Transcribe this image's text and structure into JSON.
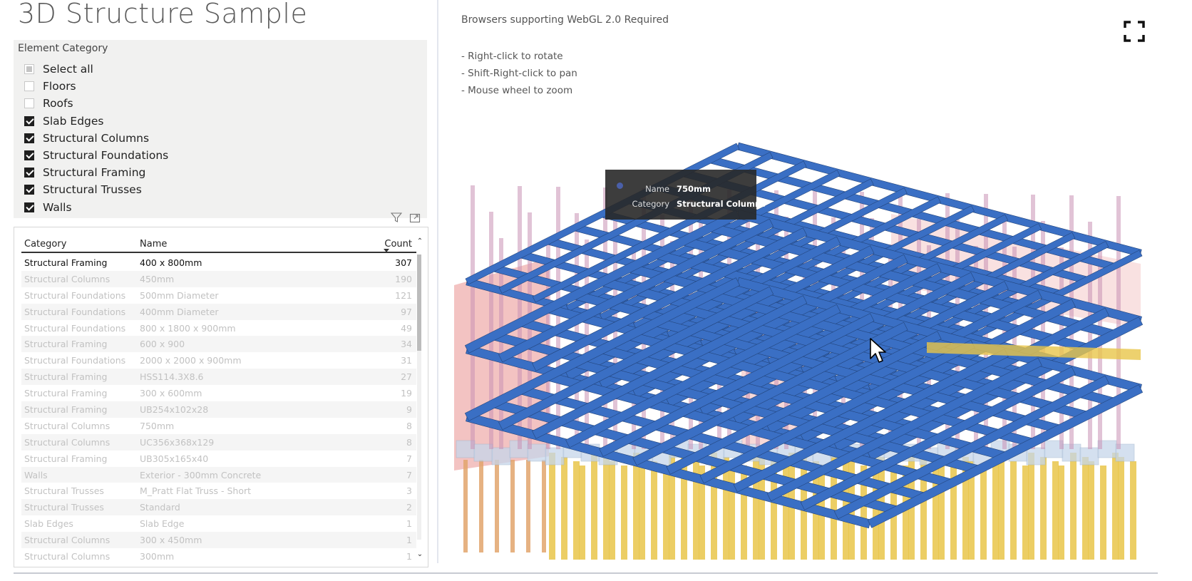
{
  "page": {
    "title": "3D Structure Sample"
  },
  "slicer": {
    "title": "Element Category",
    "items": [
      {
        "label": "Select all",
        "state": "partial"
      },
      {
        "label": "Floors",
        "state": "unchecked"
      },
      {
        "label": "Roofs",
        "state": "unchecked"
      },
      {
        "label": "Slab Edges",
        "state": "checked"
      },
      {
        "label": "Structural Columns",
        "state": "checked"
      },
      {
        "label": "Structural Foundations",
        "state": "checked"
      },
      {
        "label": "Structural Framing",
        "state": "checked"
      },
      {
        "label": "Structural Trusses",
        "state": "checked"
      },
      {
        "label": "Walls",
        "state": "checked"
      }
    ]
  },
  "visual_header_icons": [
    "filter-icon",
    "focus-mode-icon"
  ],
  "table": {
    "columns": [
      "Category",
      "Name",
      "Count"
    ],
    "sorted_column": "Count",
    "rows": [
      {
        "category": "Structural Framing",
        "name": "400 x 800mm",
        "count": "307",
        "selected": true
      },
      {
        "category": "Structural Columns",
        "name": "450mm",
        "count": "190"
      },
      {
        "category": "Structural Foundations",
        "name": "500mm Diameter",
        "count": "121"
      },
      {
        "category": "Structural Foundations",
        "name": "400mm Diameter",
        "count": "97"
      },
      {
        "category": "Structural Foundations",
        "name": "800 x 1800 x 900mm",
        "count": "49"
      },
      {
        "category": "Structural Framing",
        "name": "600 x 900",
        "count": "34"
      },
      {
        "category": "Structural Foundations",
        "name": "2000 x 2000 x 900mm",
        "count": "31"
      },
      {
        "category": "Structural Framing",
        "name": "HSS114.3X8.6",
        "count": "27"
      },
      {
        "category": "Structural Framing",
        "name": "300 x 600mm",
        "count": "19"
      },
      {
        "category": "Structural Framing",
        "name": "UB254x102x28",
        "count": "9"
      },
      {
        "category": "Structural Columns",
        "name": "750mm",
        "count": "8"
      },
      {
        "category": "Structural Columns",
        "name": "UC356x368x129",
        "count": "8"
      },
      {
        "category": "Structural Framing",
        "name": "UB305x165x40",
        "count": "7"
      },
      {
        "category": "Walls",
        "name": "Exterior - 300mm Concrete",
        "count": "7"
      },
      {
        "category": "Structural Trusses",
        "name": "M_Pratt Flat Truss - Short",
        "count": "3"
      },
      {
        "category": "Structural Trusses",
        "name": "Standard",
        "count": "2"
      },
      {
        "category": "Slab Edges",
        "name": "Slab Edge",
        "count": "1"
      },
      {
        "category": "Structural Columns",
        "name": "300 x 450mm",
        "count": "1"
      },
      {
        "category": "Structural Columns",
        "name": "300mm",
        "count": "1"
      }
    ]
  },
  "viewer": {
    "note": "Browsers supporting WebGL 2.0 Required",
    "hints": [
      "- Right-click to rotate",
      "- Shift-Right-click to pan",
      "- Mouse wheel to zoom"
    ],
    "fullscreen_icon": "fullscreen-icon",
    "tooltip": {
      "rows": [
        {
          "key": "Name",
          "value": "750mm"
        },
        {
          "key": "Category",
          "value": "Structural Columns"
        }
      ]
    },
    "colors": {
      "beams": "#3a6fc4",
      "beam_top": "#5b8ad6",
      "columns": "#c992b4",
      "walls": "#eeaaa8",
      "foundations_piles": "#e9c64a",
      "pile_caps": "#c6d6ea",
      "columns_lower": "#e2a46c"
    }
  }
}
